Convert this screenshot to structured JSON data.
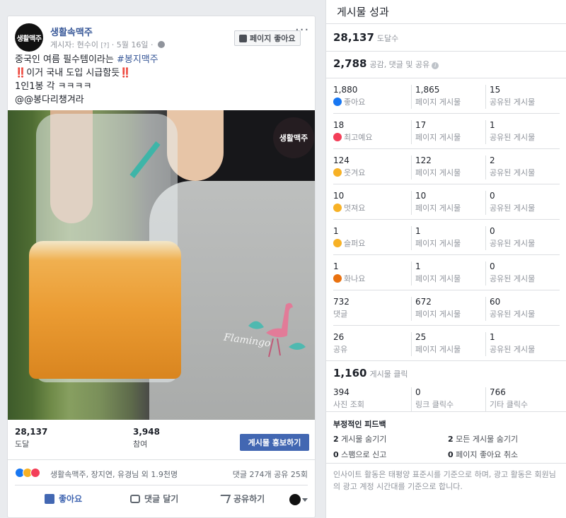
{
  "post": {
    "page_name": "생활속맥주",
    "avatar_text": "생활맥주",
    "meta": {
      "author_label": "게시자:",
      "author": "현수이",
      "author_q": "[?]",
      "date": "5월 16일"
    },
    "like_page_label": "페이지 좋아요",
    "more_label": "···",
    "text": {
      "line1_prefix": "중국인 여름 필수템이라는 ",
      "line1_hashtag": "#봉지맥주",
      "line2_bang1": "‼️",
      "line2": "이거 국내 도입 시급함듯",
      "line2_bang2": "‼️",
      "line3": "1인1봉 각 ㅋㅋㅋㅋ",
      "line4": "@@봉다리챙겨라"
    },
    "photo": {
      "watermark": "생활맥주",
      "shirt_text": "Flamingo"
    },
    "stats": [
      {
        "value": "28,137",
        "label": "도달"
      },
      {
        "value": "3,948",
        "label": "참여"
      }
    ],
    "promote_label": "게시물 홍보하기",
    "reactions": {
      "icons": [
        "like-icon",
        "haha-icon",
        "love-icon"
      ],
      "names": "생활속맥주, 장지연, 유경님 외 1.9천명",
      "counts": "댓글 274개   공유 25회"
    },
    "actions": {
      "like": "좋아요",
      "comment": "댓글 달기",
      "share": "공유하기"
    }
  },
  "panel": {
    "title": "게시물 성과",
    "reach": {
      "value": "28,137",
      "label": "도달수"
    },
    "engagement": {
      "value": "2,788",
      "label": "공감, 댓글 및 공유"
    },
    "rows": [
      {
        "v1": "1,880",
        "l1": "좋아요",
        "icon": "like",
        "v2": "1,865",
        "l2": "페이지 게시물",
        "v3": "15",
        "l3": "공유된 게시물"
      },
      {
        "v1": "18",
        "l1": "최고예요",
        "icon": "love",
        "v2": "17",
        "l2": "페이지 게시물",
        "v3": "1",
        "l3": "공유된 게시물"
      },
      {
        "v1": "124",
        "l1": "웃겨요",
        "icon": "haha",
        "v2": "122",
        "l2": "페이지 게시물",
        "v3": "2",
        "l3": "공유된 게시물"
      },
      {
        "v1": "10",
        "l1": "멋져요",
        "icon": "wow",
        "v2": "10",
        "l2": "페이지 게시물",
        "v3": "0",
        "l3": "공유된 게시물"
      },
      {
        "v1": "1",
        "l1": "슬퍼요",
        "icon": "sad",
        "v2": "1",
        "l2": "페이지 게시물",
        "v3": "0",
        "l3": "공유된 게시물"
      },
      {
        "v1": "1",
        "l1": "화나요",
        "icon": "angry",
        "v2": "1",
        "l2": "페이지 게시물",
        "v3": "0",
        "l3": "공유된 게시물"
      },
      {
        "v1": "732",
        "l1": "댓글",
        "icon": "",
        "v2": "672",
        "l2": "페이지 게시물",
        "v3": "60",
        "l3": "공유된 게시물"
      },
      {
        "v1": "26",
        "l1": "공유",
        "icon": "",
        "v2": "25",
        "l2": "페이지 게시물",
        "v3": "1",
        "l3": "공유된 게시물"
      }
    ],
    "clicks": {
      "value": "1,160",
      "label": "게시물 클릭"
    },
    "click_rows": [
      {
        "v": "394",
        "l": "사진 조회"
      },
      {
        "v": "0",
        "l": "링크 클릭수"
      },
      {
        "v": "766",
        "l": "기타 클릭수"
      }
    ],
    "negative": {
      "title": "부정적인 피드백",
      "items": [
        {
          "v": "2",
          "l": "게시물 숨기기"
        },
        {
          "v": "2",
          "l": "모든 게시물 숨기기"
        },
        {
          "v": "0",
          "l": "스팸으로 신고"
        },
        {
          "v": "0",
          "l": "페이지 좋아요 취소"
        }
      ]
    },
    "footnote": "인사이트 활동은 태평양 표준시를 기준으로 하며, 광고 활동은 회원님의 광고 계정 시간대를 기준으로 합니다."
  }
}
